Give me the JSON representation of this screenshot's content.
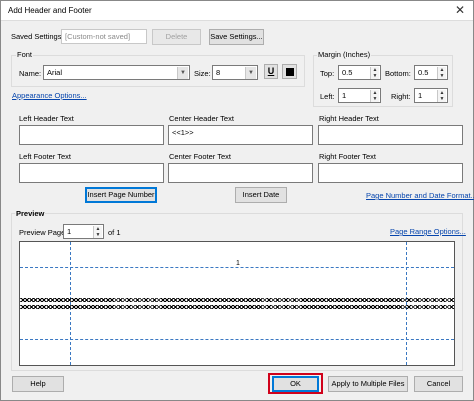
{
  "window": {
    "title": "Add Header and Footer"
  },
  "saved_settings": {
    "label": "Saved Settings:",
    "value": "[Custom-not saved]",
    "delete_label": "Delete",
    "save_label": "Save Settings..."
  },
  "font": {
    "group_label": "Font",
    "name_label": "Name:",
    "name_value": "Arial",
    "size_label": "Size:",
    "size_value": "8",
    "underline_label": "U",
    "text_color": "#000000"
  },
  "margin": {
    "group_label": "Margin (Inches)",
    "top_label": "Top:",
    "top_value": "0.5",
    "bottom_label": "Bottom:",
    "bottom_value": "0.5",
    "left_label": "Left:",
    "left_value": "1",
    "right_label": "Right:",
    "right_value": "1"
  },
  "appearance_link": "Appearance Options...",
  "header": {
    "left_label": "Left Header Text",
    "center_label": "Center Header Text",
    "center_value": "<<1>>",
    "right_label": "Right Header Text"
  },
  "footer": {
    "left_label": "Left Footer Text",
    "center_label": "Center Footer Text",
    "right_label": "Right Footer Text"
  },
  "insert_page_number": "Insert Page Number",
  "insert_date": "Insert Date",
  "page_number_link": "Page Number and Date Format...",
  "preview": {
    "label": "Preview",
    "page_label": "Preview Page",
    "page_value": "1",
    "of_label": "of 1",
    "range_link": "Page Range Options...",
    "header_preview_text": "1"
  },
  "footer_buttons": {
    "help": "Help",
    "ok": "OK",
    "apply_multiple": "Apply to Multiple Files",
    "cancel": "Cancel"
  },
  "colors": {
    "highlight": "#d0021b",
    "link": "#0645ad",
    "guide": "#3a78c2"
  }
}
